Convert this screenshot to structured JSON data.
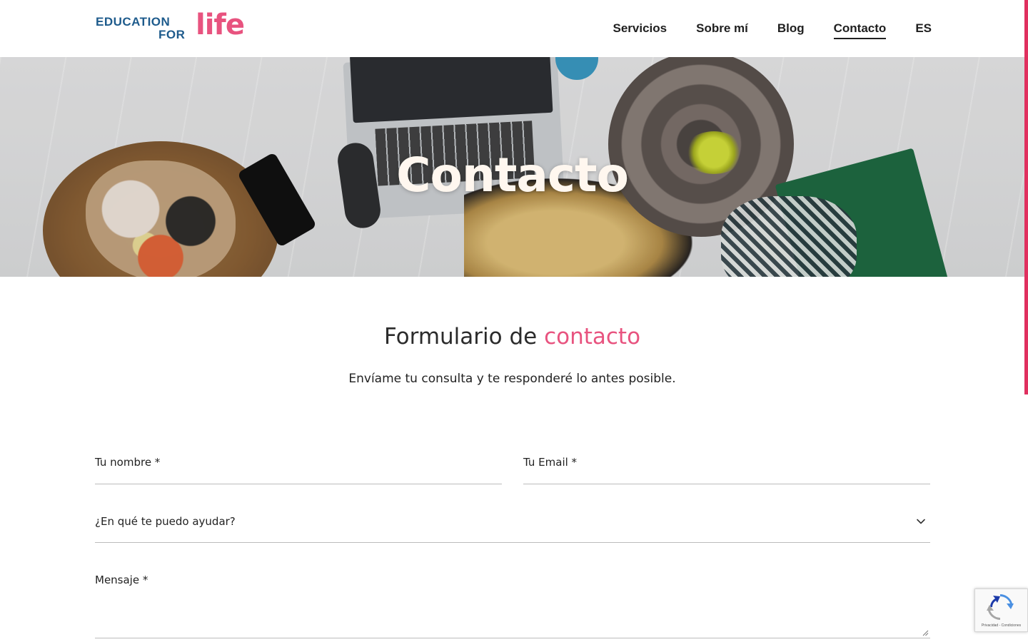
{
  "header": {
    "logo": {
      "line1": "EDUCATION",
      "line2": "FOR",
      "life": "life"
    },
    "nav": [
      {
        "label": "Servicios",
        "active": false
      },
      {
        "label": "Sobre mí",
        "active": false
      },
      {
        "label": "Blog",
        "active": false
      },
      {
        "label": "Contacto",
        "active": true
      },
      {
        "label": "ES",
        "active": false
      }
    ]
  },
  "hero": {
    "title": "Contacto"
  },
  "form_section": {
    "title_prefix": "Formulario de",
    "title_accent": "contacto",
    "subtitle": "Envíame tu consulta y te responderé lo antes posible.",
    "fields": {
      "name_label": "Tu nombre *",
      "email_label": "Tu Email *",
      "help_select_label": "¿En qué te puedo ayudar?",
      "message_label": "Mensaje *"
    }
  },
  "recaptcha": {
    "text": "Privacidad - Condiciones"
  },
  "colors": {
    "accent_pink": "#e8537f",
    "logo_blue": "#1e5b8c",
    "scroll_indicator": "#e0305f"
  },
  "icons": {
    "select_chevron": "chevron-down-icon",
    "recaptcha": "recaptcha-icon",
    "textarea_resize": "resize-handle-icon"
  }
}
